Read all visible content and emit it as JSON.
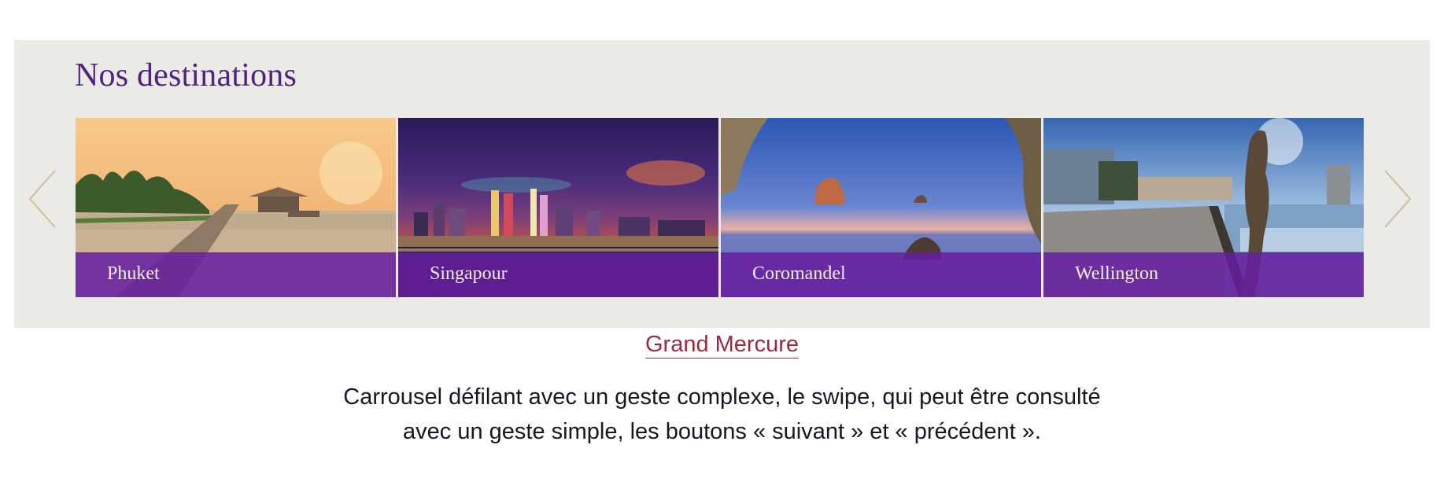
{
  "carousel": {
    "title": "Nos destinations",
    "prev_icon": "chevron-left-icon",
    "next_icon": "chevron-right-icon",
    "arrow_color": "#c9bf99",
    "caption_color": "#6a1ea3",
    "slides": [
      {
        "label": "Phuket",
        "image": "tropical-pier-sunset-photo"
      },
      {
        "label": "Singapour",
        "image": "city-skyline-night-photo"
      },
      {
        "label": "Coromandel",
        "image": "sea-rock-cove-photo"
      },
      {
        "label": "Wellington",
        "image": "waterfront-statue-photo"
      }
    ]
  },
  "source": {
    "link_text": "Grand Mercure",
    "color": "#9b2a3d"
  },
  "description": {
    "line1": "Carrousel défilant avec un geste complexe, le swipe, qui peut être consulté",
    "line2": "avec un geste simple, les boutons « suivant » et « précédent »."
  }
}
